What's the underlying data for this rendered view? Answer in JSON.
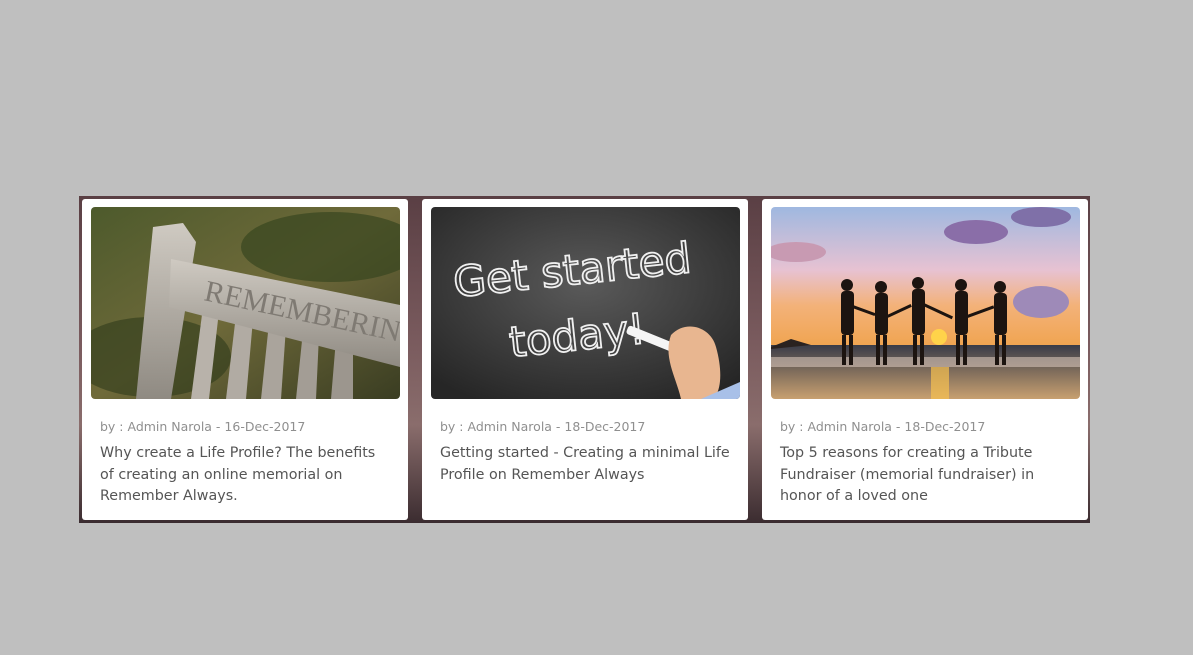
{
  "cards": [
    {
      "image_alt": "Wooden bench engraved REMEMBERING",
      "image_text": "REMEMBERING",
      "meta": "by : Admin Narola - 16-Dec-2017",
      "title": "Why create a Life Profile? The benefits of creating an online memorial on Remember Always."
    },
    {
      "image_alt": "Chalkboard reading Get started today!",
      "image_text_line1": "Get started",
      "image_text_line2": "today!",
      "meta": "by : Admin Narola - 18-Dec-2017",
      "title": "Getting started - Creating a minimal Life Profile on Remember Always"
    },
    {
      "image_alt": "Silhouettes of five people holding hands at sunset on a beach",
      "meta": "by : Admin Narola - 18-Dec-2017",
      "title": "Top 5 reasons for creating a Tribute Fundraiser (memorial fundraiser) in honor of a loved one"
    }
  ],
  "colors": {
    "page_background": "#bfbfbf",
    "card_background": "#ffffff",
    "meta_text": "#8f8f8f",
    "title_text": "#555555"
  }
}
